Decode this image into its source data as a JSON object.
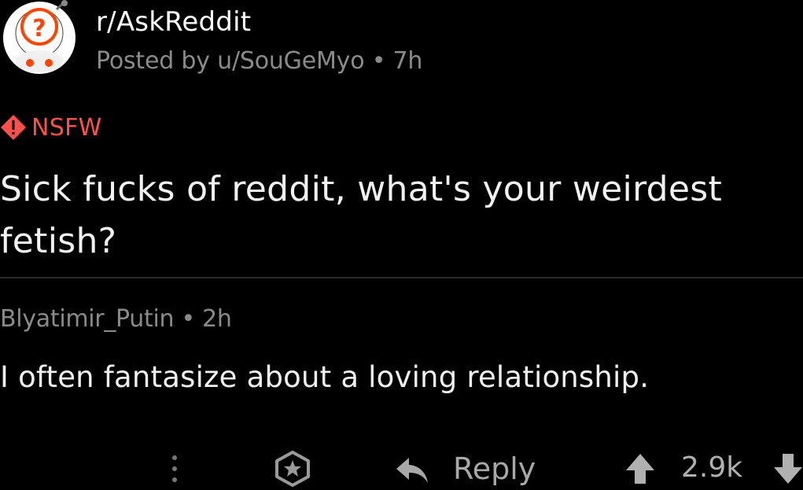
{
  "post": {
    "subreddit": "r/AskReddit",
    "posted_by": "Posted by u/SouGeMyo • 7h",
    "nsfw_label": "NSFW",
    "title": "Sick fucks of reddit, what's your weirdest fetish?"
  },
  "comment": {
    "meta": "Blyatimir_Putin • 2h",
    "body": "I often fantasize about a loving relationship."
  },
  "actions": {
    "reply_label": "Reply",
    "score": "2.9k"
  },
  "icons": {
    "avatar": "askreddit-snoo-icon",
    "nsfw": "warning-diamond-icon",
    "more": "more-vertical-icon",
    "award": "award-icon",
    "reply": "reply-arrow-icon",
    "upvote": "upvote-icon",
    "downvote": "downvote-icon"
  },
  "colors": {
    "background": "#000000",
    "nsfw": "#ff4f4a",
    "muted": "#8a8a8a"
  }
}
